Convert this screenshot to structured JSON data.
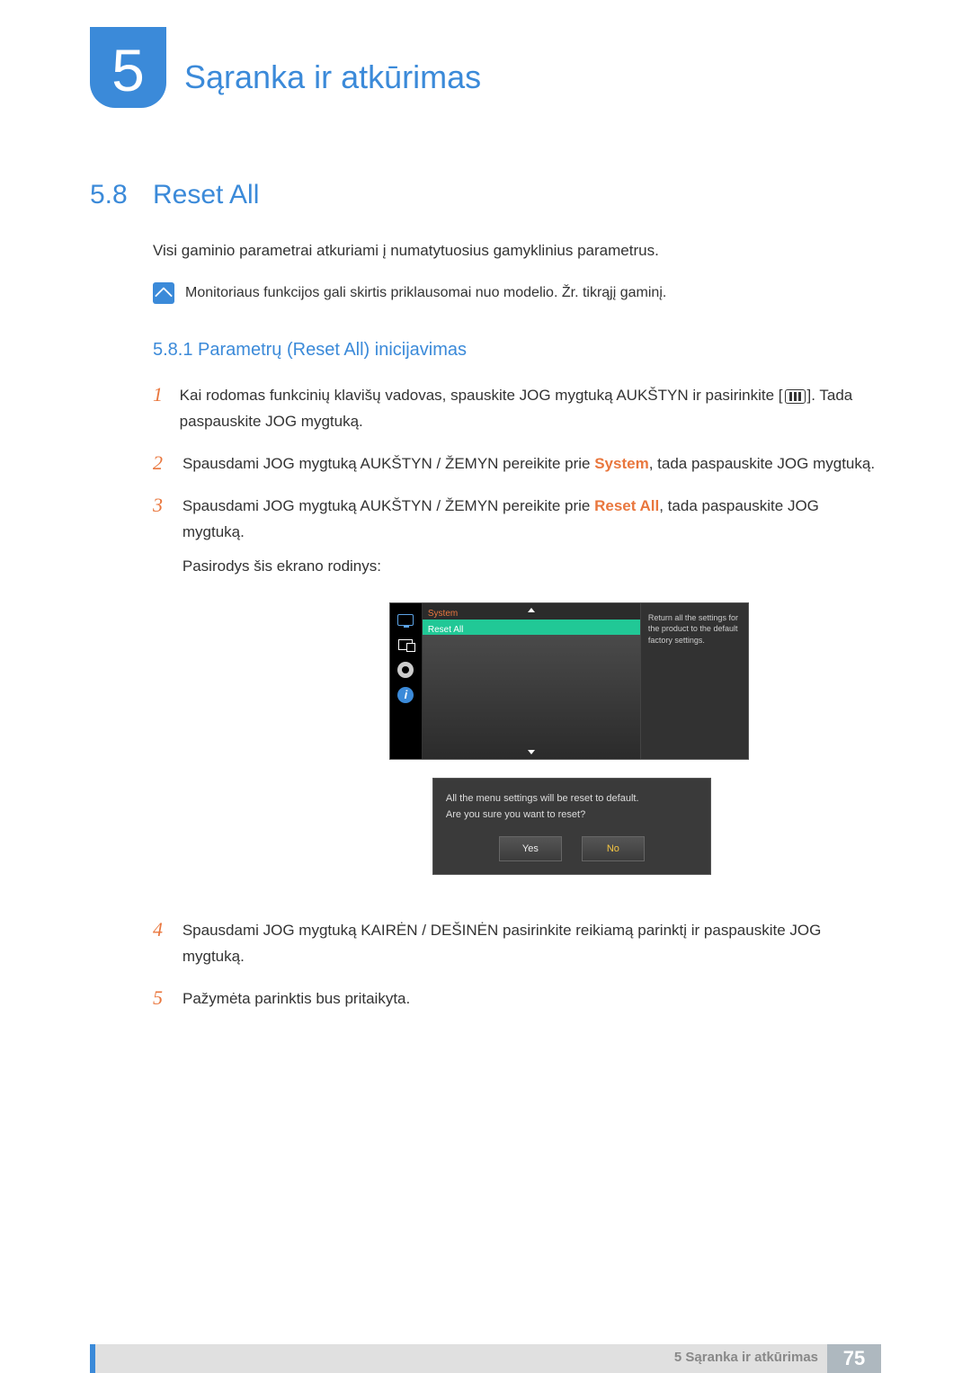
{
  "chapter": {
    "number": "5",
    "title": "Sąranka ir atkūrimas"
  },
  "section": {
    "number": "5.8",
    "title": "Reset All"
  },
  "intro": "Visi gaminio parametrai atkuriami į numatytuosius gamyklinius parametrus.",
  "note": "Monitoriaus funkcijos gali skirtis priklausomai nuo modelio. Žr. tikrąjį gaminį.",
  "subsection": "5.8.1   Parametrų (Reset All) inicijavimas",
  "steps": {
    "s1a": "Kai rodomas funkcinių klavišų vadovas, spauskite JOG mygtuką AUKŠTYN ir pasirinkite [",
    "s1b": "]. Tada paspauskite JOG mygtuką.",
    "s2a": "Spausdami JOG mygtuką AUKŠTYN / ŽEMYN pereikite prie ",
    "s2b": "System",
    "s2c": ", tada paspauskite JOG mygtuką.",
    "s3a": "Spausdami JOG mygtuką AUKŠTYN / ŽEMYN pereikite prie ",
    "s3b": "Reset All",
    "s3c": ", tada paspauskite JOG mygtuką.",
    "s3d": "Pasirodys šis ekrano rodinys:",
    "s4": "Spausdami JOG mygtuką KAIRĖN / DEŠINĖN pasirinkite reikiamą parinktį ir paspauskite JOG mygtuką.",
    "s5": "Pažymėta parinktis bus pritaikyta."
  },
  "osd1": {
    "title": "System",
    "highlight": "Reset All",
    "desc": "Return all the settings for the product to the default factory settings."
  },
  "osd2": {
    "line1": "All the menu settings will be reset to default.",
    "line2": "Are you sure you want to reset?",
    "yes": "Yes",
    "no": "No"
  },
  "footer": {
    "label": "5 Sąranka ir atkūrimas",
    "page": "75"
  }
}
